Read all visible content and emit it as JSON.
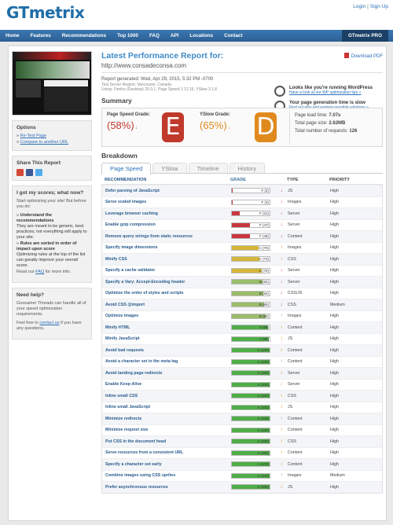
{
  "header": {
    "logo": "GTmetrix",
    "links": [
      "Login",
      "Sign Up"
    ]
  },
  "nav": {
    "items": [
      "Home",
      "Features",
      "Recommendations",
      "Top 1000",
      "FAQ",
      "API",
      "Locations",
      "Contact"
    ],
    "pro": "GTmetrix PRO"
  },
  "sidebar": {
    "options_title": "Options",
    "options": [
      "Re-Test Page",
      "Compare to another URL"
    ],
    "share_title": "Share This Report",
    "scores_title": "I got my scores; what now?",
    "scores_intro": "Start optimizing your site! But before you do:",
    "scores_points": [
      {
        "head": "Understand the recommendations",
        "body": "They are meant to be generic, best practices; not everything will apply to your site."
      },
      {
        "head": "Rules are sorted in order of impact upon score",
        "body": "Optimizing rules at the top of the list can greatly improve your overall score."
      }
    ],
    "scores_read_pre": "Read our",
    "scores_read_link": "FAQ",
    "scores_read_post": "for more info.",
    "help_title": "Need help?",
    "help_body": "Gossamer Threads can handle all of your speed optimization requirements.",
    "help_feel_pre": "Feel free to",
    "help_feel_link": "contact us",
    "help_feel_post": "if you have any questions."
  },
  "report": {
    "title": "Latest Performance Report for:",
    "url": "http://www.consadeconsa.com",
    "download": "Download PDF",
    "generated": "Report generated: Wed, Apr 29, 2015, 5:32 PM -0700",
    "server": "Test Server Region: Vancouver, Canada",
    "using": "Using: Firefox (Desktop) 25.0.1, Page Speed 1.12.16, YSlow 3.1.8",
    "tip1_title": "Looks like you're running WordPress",
    "tip1_link": "Have a look at our WP optimization tips »",
    "tip2_title": "Your page generation time is slow",
    "tip2_link": "Find out why and explore possible solutions »"
  },
  "summary": {
    "heading": "Summary",
    "ps_label": "Page Speed Grade:",
    "ps_score": "(58%)",
    "ps_grade": "E",
    "ys_label": "YSlow Grade:",
    "ys_score": "(65%)",
    "ys_grade": "D",
    "load_label": "Page load time:",
    "load_value": "7.07s",
    "size_label": "Total page size:",
    "size_value": "2.62MB",
    "req_label": "Total number of requests:",
    "req_value": "126"
  },
  "breakdown": {
    "heading": "Breakdown",
    "tabs": [
      "Page Speed",
      "YSlow",
      "Timeline",
      "History"
    ],
    "columns": [
      "RECOMMENDATION",
      "GRADE",
      "TYPE",
      "PRIORITY"
    ],
    "rows": [
      {
        "name": "Defer parsing of JavaScript",
        "grade": "F (2)",
        "score": 2,
        "arrow": "↓",
        "type": "JS",
        "priority": "High"
      },
      {
        "name": "Serve scaled images",
        "grade": "F (2)",
        "score": 2,
        "arrow": "↓",
        "type": "Images",
        "priority": "High"
      },
      {
        "name": "Leverage browser caching",
        "grade": "F (21)",
        "score": 21,
        "arrow": "↓",
        "type": "Server",
        "priority": "High"
      },
      {
        "name": "Enable gzip compression",
        "grade": "F (47)",
        "score": 47,
        "arrow": "↓",
        "type": "Server",
        "priority": "High"
      },
      {
        "name": "Remove query strings from static resources",
        "grade": "F (48)",
        "score": 48,
        "arrow": "↓",
        "type": "Content",
        "priority": "High"
      },
      {
        "name": "Specify image dimensions",
        "grade": "C (70)",
        "score": 70,
        "arrow": "↕",
        "type": "Images",
        "priority": "High"
      },
      {
        "name": "Minify CSS",
        "grade": "C (73)",
        "score": 73,
        "arrow": "↕",
        "type": "CSS",
        "priority": "High"
      },
      {
        "name": "Specify a cache validator",
        "grade": "C (79)",
        "score": 79,
        "arrow": "↓",
        "type": "Server",
        "priority": "High"
      },
      {
        "name": "Specify a Vary: Accept-Encoding header",
        "grade": "B (82)",
        "score": 82,
        "arrow": "↓",
        "type": "Server",
        "priority": "High"
      },
      {
        "name": "Optimize the order of styles and scripts",
        "grade": "B (84)",
        "score": 84,
        "arrow": "↓",
        "type": "CSS/JS",
        "priority": "High"
      },
      {
        "name": "Avoid CSS @import",
        "grade": "B (85)",
        "score": 85,
        "arrow": "↓",
        "type": "CSS",
        "priority": "Medium"
      },
      {
        "name": "Optimize images",
        "grade": "B (89)",
        "score": 89,
        "arrow": "↑",
        "type": "Images",
        "priority": "High"
      },
      {
        "name": "Minify HTML",
        "grade": "A (96)",
        "score": 96,
        "arrow": "↕",
        "type": "Content",
        "priority": "High"
      },
      {
        "name": "Minify JavaScript",
        "grade": "A (98)",
        "score": 98,
        "arrow": "↕",
        "type": "JS",
        "priority": "High"
      },
      {
        "name": "Avoid bad requests",
        "grade": "A (100)",
        "score": 100,
        "arrow": "↕",
        "type": "Content",
        "priority": "High"
      },
      {
        "name": "Avoid a character set in the meta tag",
        "grade": "A (100)",
        "score": 100,
        "arrow": "↑",
        "type": "Content",
        "priority": "High"
      },
      {
        "name": "Avoid landing page redirects",
        "grade": "A (100)",
        "score": 100,
        "arrow": "↕",
        "type": "Server",
        "priority": "High"
      },
      {
        "name": "Enable Keep-Alive",
        "grade": "A (100)",
        "score": 100,
        "arrow": "↕",
        "type": "Server",
        "priority": "High"
      },
      {
        "name": "Inline small CSS",
        "grade": "A (100)",
        "score": 100,
        "arrow": "↕",
        "type": "CSS",
        "priority": "High"
      },
      {
        "name": "Inline small JavaScript",
        "grade": "A (100)",
        "score": 100,
        "arrow": "↕",
        "type": "JS",
        "priority": "High"
      },
      {
        "name": "Minimize redirects",
        "grade": "A (100)",
        "score": 100,
        "arrow": "↑",
        "type": "Content",
        "priority": "High"
      },
      {
        "name": "Minimize request size",
        "grade": "A (100)",
        "score": 100,
        "arrow": "↕",
        "type": "Content",
        "priority": "High"
      },
      {
        "name": "Put CSS in the document head",
        "grade": "A (100)",
        "score": 100,
        "arrow": "↕",
        "type": "CSS",
        "priority": "High"
      },
      {
        "name": "Serve resources from a consistent URL",
        "grade": "A (100)",
        "score": 100,
        "arrow": "↕",
        "type": "Content",
        "priority": "High"
      },
      {
        "name": "Specify a character set early",
        "grade": "A (100)",
        "score": 100,
        "arrow": "↕",
        "type": "Content",
        "priority": "High"
      },
      {
        "name": "Combine images using CSS sprites",
        "grade": "A (100)",
        "score": 100,
        "arrow": "↑",
        "type": "Images",
        "priority": "Medium"
      },
      {
        "name": "Prefer asynchronous resources",
        "grade": "A (100)",
        "score": 100,
        "arrow": "↕",
        "type": "JS",
        "priority": "High"
      }
    ]
  },
  "colors": {
    "grade_e": "#c0392b",
    "grade_d": "#e08a1e",
    "bar_f": "#c9363e",
    "bar_c": "#d4b73a",
    "bar_b": "#9bbd6a",
    "bar_a": "#4fae48"
  }
}
